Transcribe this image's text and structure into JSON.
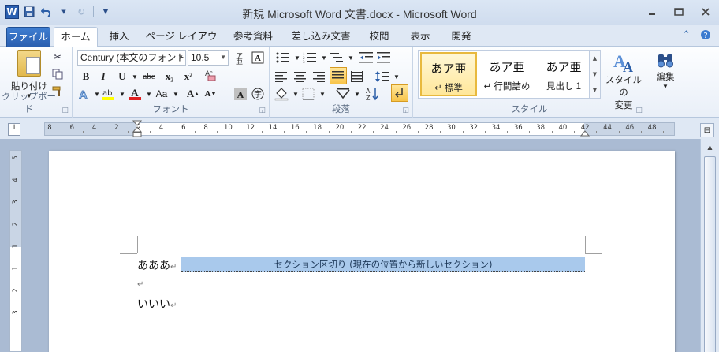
{
  "window": {
    "title": "新規 Microsoft Word 文書.docx - Microsoft Word",
    "app_icon": "W",
    "controls": [
      "minimize-icon",
      "maximize-icon",
      "close-icon"
    ]
  },
  "quick_access": {
    "save": "save-icon",
    "undo": "undo-icon",
    "redo": "redo-icon",
    "customize": "customize-icon"
  },
  "tabs": [
    {
      "label": "ファイル"
    },
    {
      "label": "ホーム"
    },
    {
      "label": "挿入"
    },
    {
      "label": "ページ レイアウト"
    },
    {
      "label": "参考資料"
    },
    {
      "label": "差し込み文書"
    },
    {
      "label": "校閲"
    },
    {
      "label": "表示"
    },
    {
      "label": "開発"
    }
  ],
  "ribbon": {
    "clipboard": {
      "label": "クリップボード",
      "paste_label": "貼り付け"
    },
    "font": {
      "label": "フォント",
      "font_name": "Century (本文のフォント",
      "font_size": "10.5",
      "buttons": [
        "B",
        "I",
        "U",
        "abc",
        "x₂",
        "x²",
        "Aa",
        "A",
        "A"
      ]
    },
    "paragraph": {
      "label": "段落"
    },
    "styles": {
      "label": "スタイル",
      "items": [
        {
          "sample": "あア亜",
          "name": "↵ 標準"
        },
        {
          "sample": "あア亜",
          "name": "↵ 行間詰め"
        },
        {
          "sample": "あア亜",
          "name": "見出し 1"
        }
      ],
      "change_label_1": "スタイルの",
      "change_label_2": "変更"
    },
    "editing": {
      "label": "編集"
    }
  },
  "ruler": {
    "numbers": [
      "8",
      "6",
      "4",
      "2",
      "2",
      "4",
      "6",
      "8",
      "10",
      "12",
      "14",
      "16",
      "18",
      "20",
      "22",
      "24",
      "26",
      "28",
      "30",
      "32",
      "34",
      "36",
      "38",
      "40",
      "42",
      "44",
      "46",
      "48"
    ],
    "vertical_numbers": [
      "5",
      "4",
      "3",
      "2",
      "1",
      "1",
      "2",
      "3"
    ]
  },
  "document": {
    "line1": "あああ",
    "section_break": "セクション区切り (現在の位置から新しいセクション)",
    "line2": "",
    "line3": "いいい",
    "para_mark": "↵"
  }
}
